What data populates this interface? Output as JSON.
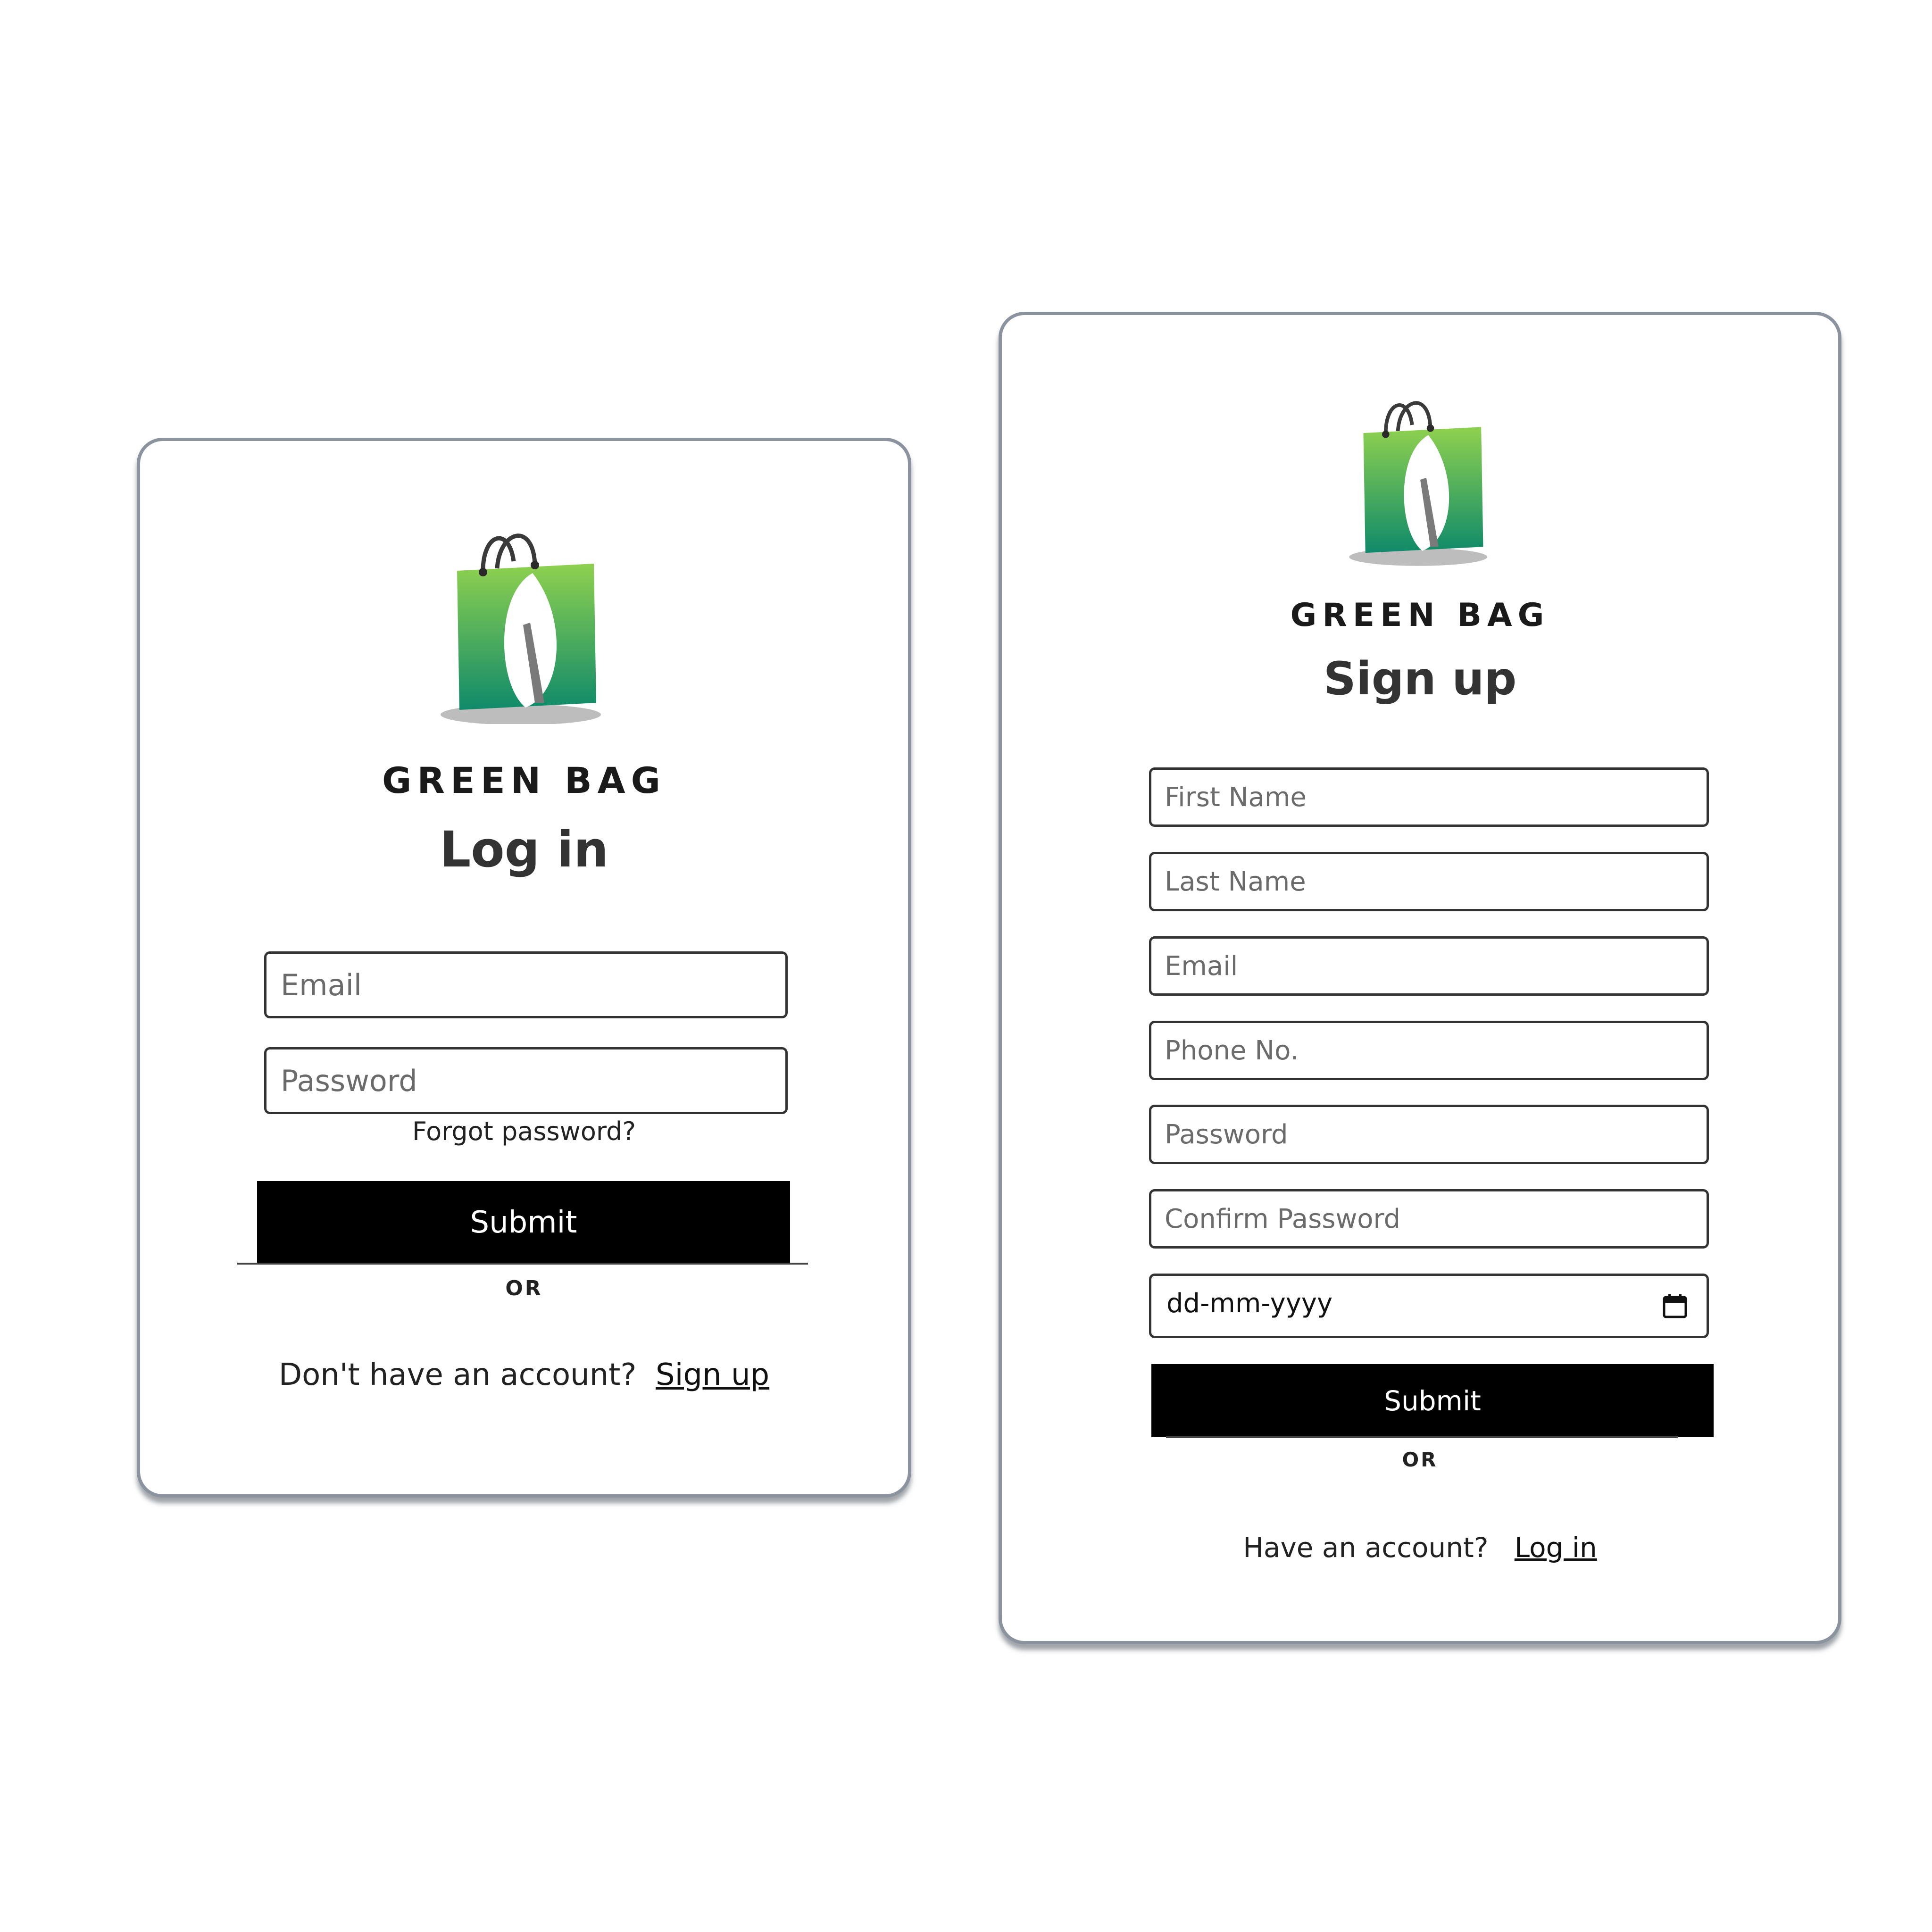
{
  "brand": {
    "name": "GREEN BAG",
    "colors": {
      "bag_light": "#8fd14f",
      "bag_dark": "#0f8a6a",
      "handle": "#3a3a3a",
      "leaf": "#ffffff",
      "shadow": "#bdbdbd"
    }
  },
  "login": {
    "title": "Log in",
    "email_placeholder": "Email",
    "password_placeholder": "Password",
    "forgot_password": "Forgot password?",
    "submit": "Submit",
    "or": "OR",
    "no_account_text": "Don't have an account?",
    "signup_link": "Sign up"
  },
  "signup": {
    "title": "Sign up",
    "first_name_placeholder": "First Name",
    "last_name_placeholder": "Last Name",
    "email_placeholder": "Email",
    "phone_placeholder": "Phone No.",
    "password_placeholder": "Password",
    "confirm_password_placeholder": "Confirm Password",
    "date_placeholder": "dd-mm-yyyy",
    "submit": "Submit",
    "or": "OR",
    "have_account_text": "Have an account?",
    "login_link": "Log in"
  },
  "icons": {
    "logo": "shopping-bag-leaf",
    "calendar": "calendar-icon"
  }
}
